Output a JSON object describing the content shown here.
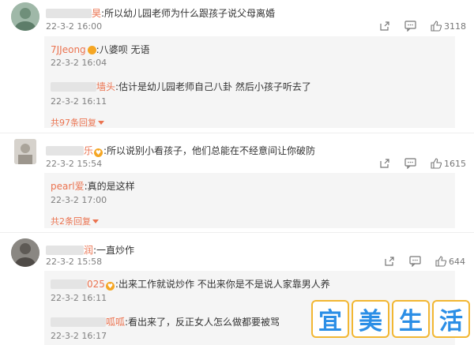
{
  "comments": [
    {
      "name_suffix": "昊",
      "text": ":所以幼儿园老师为什么跟孩子说父母离婚",
      "time": "22-3-2 16:00",
      "likes": "3118",
      "replies": [
        {
          "name": "7JJeong",
          "text": ":八婆呗 无语",
          "time": "22-3-2 16:04"
        },
        {
          "name_suffix": "墙头",
          "text": ":估计是幼儿园老师自己八卦 然后小孩子听去了",
          "time": "22-3-2 16:11"
        }
      ],
      "more": "共97条回复"
    },
    {
      "name_suffix": "乐",
      "text": ":所以说别小看孩子，他们总能在不经意间让你破防",
      "time": "22-3-2 15:54",
      "likes": "1615",
      "replies": [
        {
          "name": "pearl爱",
          "text": ":真的是这样",
          "time": "22-3-2 17:00"
        }
      ],
      "more": "共2条回复"
    },
    {
      "name_suffix": "润",
      "text": ":一直炒作",
      "time": "22-3-2 15:58",
      "likes": "644",
      "replies": [
        {
          "name_suffix": "025",
          "text": ":出来工作就说炒作 不出来你是不是说人家靠男人养",
          "time": "22-3-2 16:11"
        },
        {
          "name_suffix": "呱呱",
          "text": ":看出来了，反正女人怎么做都要被骂",
          "time": "22-3-2 16:17"
        }
      ]
    }
  ],
  "watermark": [
    "宜",
    "美",
    "生",
    "活"
  ],
  "colors": {
    "name": "#eb7350",
    "reply_bg": "#f5f5f5",
    "watermark_text": "#2b8ee6",
    "watermark_border": "#f2b733"
  }
}
